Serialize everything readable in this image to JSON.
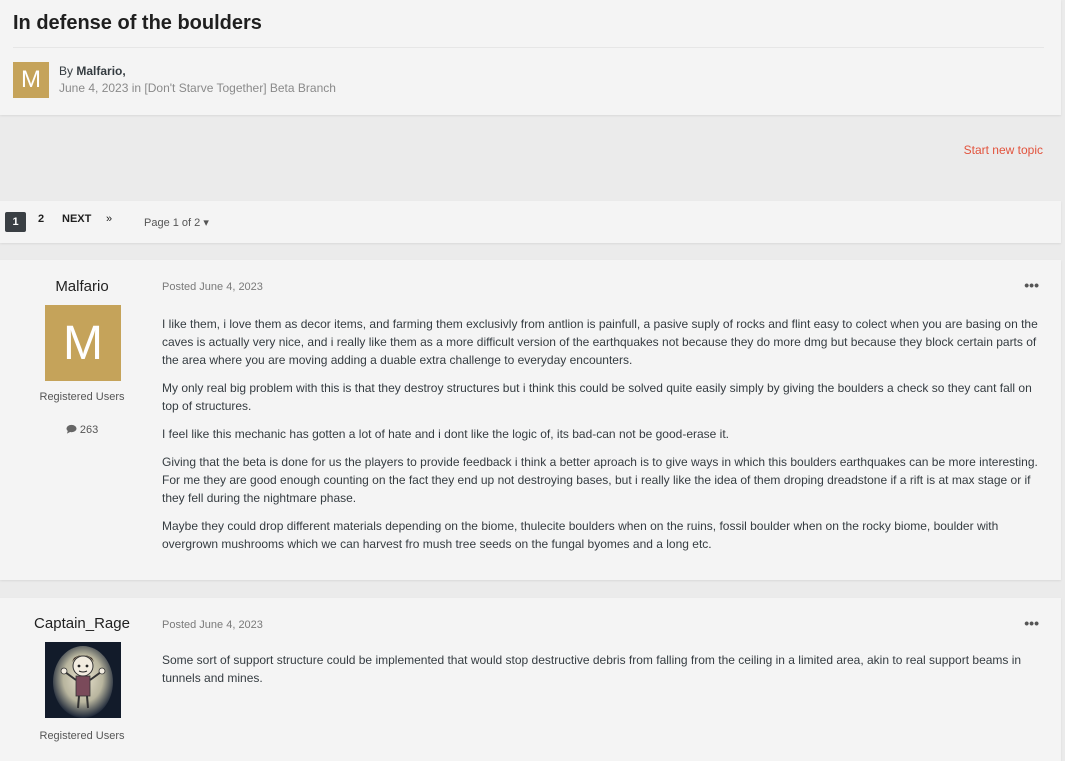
{
  "topic": {
    "title": "In defense of the boulders",
    "author_initial": "M",
    "byline_prefix": "By",
    "byline_author": "Malfario,",
    "meta": "June 4, 2023 in [Don't Starve Together] Beta Branch"
  },
  "actions": {
    "start_new_topic": "Start new topic"
  },
  "pagination": {
    "current": "1",
    "page2": "2",
    "next": "NEXT",
    "last": "»",
    "page_jump": "Page 1 of 2 ▾"
  },
  "posts": [
    {
      "author": "Malfario",
      "avatar_initial": "M",
      "group": "Registered Users",
      "count_icon": "comment-icon",
      "post_count": "263",
      "date": "Posted June 4, 2023",
      "menu": "•••",
      "paragraphs": [
        "I like them, i love them as decor items, and farming them exclusivly from antlion is painfull, a pasive suply of rocks and flint easy to colect when you are basing on the caves is actually very nice, and i really like them as a more difficult version of the earthquakes not because they do more dmg but because they block certain parts of the area where you are moving adding a duable extra challenge to everyday encounters.",
        "My only real big problem with this is that they destroy structures but i think this could be solved quite easily simply by giving the boulders a check so they cant fall on top of structures.",
        "I feel like this mechanic has gotten a lot of hate and i dont like the logic of, its bad-can not be good-erase it.",
        "Giving that the beta is done for us the players to provide feedback i think a better aproach is to give ways in which this boulders earthquakes can be more interesting. For me they are good enough counting on the fact they end up not destroying bases, but i really like the idea of them droping dreadstone if a rift is at max stage or if they fell during the nightmare phase.",
        "Maybe they could drop different materials depending on the biome, thulecite boulders when on the ruins, fossil boulder when on the rocky biome, boulder with overgrown mushrooms which we can harvest fro mush tree seeds on the fungal byomes and a long etc."
      ]
    },
    {
      "author": "Captain_Rage",
      "group": "Registered Users",
      "date": "Posted June 4, 2023",
      "menu": "•••",
      "paragraphs": [
        "Some sort of support structure could be implemented that would stop destructive debris from falling from the ceiling in a limited area, akin to real support beams in tunnels and mines."
      ]
    }
  ]
}
